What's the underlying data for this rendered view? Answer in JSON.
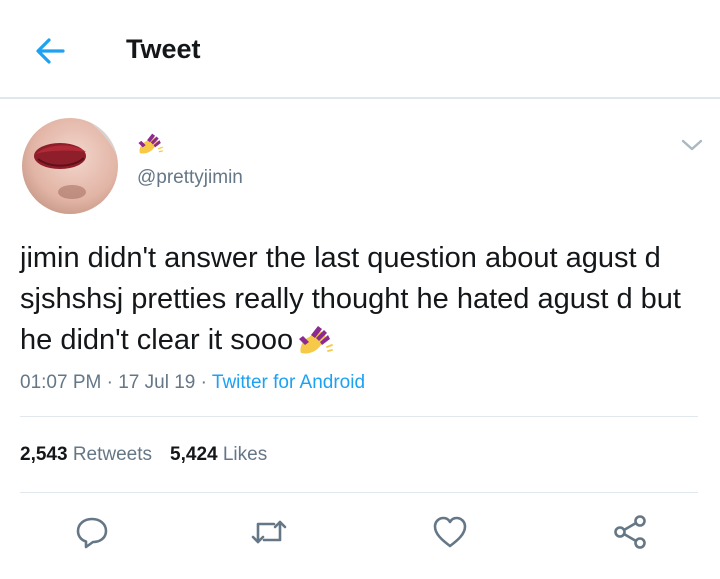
{
  "header": {
    "title": "Tweet",
    "back_icon": "arrow-left-icon"
  },
  "author": {
    "display_name_emoji": "nail-polish-emoji",
    "handle": "@prettyjimin",
    "avatar": "avatar-photo"
  },
  "tweet": {
    "text": "jimin didn't answer the last question about agust d sjshshsj pretties really thought he hated agust d but he didn't clear it sooo",
    "trailing_emoji": "nail-polish-emoji",
    "time": "01:07 PM",
    "sep1": " · ",
    "date": "17 Jul 19",
    "sep2": " · ",
    "source": "Twitter for Android"
  },
  "stats": {
    "retweets_count": "2,543",
    "retweets_label": "Retweets",
    "likes_count": "5,424",
    "likes_label": "Likes"
  },
  "actions": [
    "reply-icon",
    "retweet-icon",
    "like-icon",
    "share-icon"
  ],
  "colors": {
    "accent": "#1da1f2",
    "secondary_text": "#657786",
    "divider": "#e1e8ed",
    "text": "#14171a"
  }
}
